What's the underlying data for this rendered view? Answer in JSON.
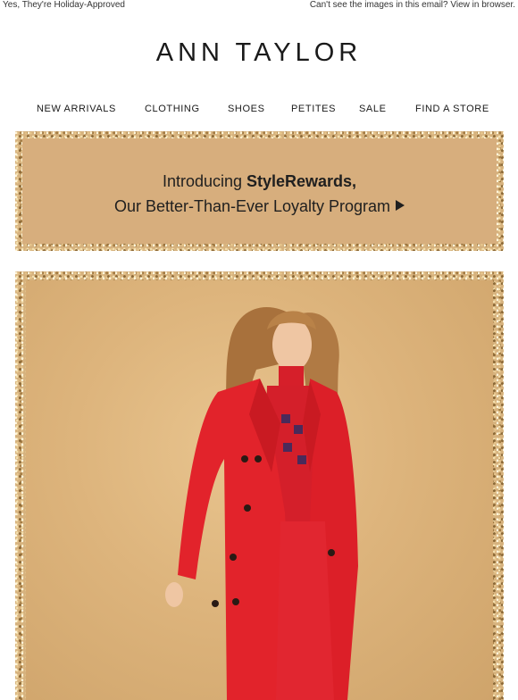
{
  "preheader": {
    "left_text": "Yes, They're Holiday-Approved",
    "right_text": "Can't see the images in this email? View in browser."
  },
  "brand": {
    "logo_text": "ANN TAYLOR"
  },
  "nav": {
    "items": [
      {
        "label": "NEW ARRIVALS"
      },
      {
        "label": "CLOTHING"
      },
      {
        "label": "SHOES"
      },
      {
        "label": "PETITES"
      },
      {
        "label": "SALE"
      },
      {
        "label": "FIND A STORE"
      }
    ]
  },
  "promo": {
    "line1_prefix": "Introducing ",
    "line1_bold": "StyleRewards,",
    "line2": "Our Better-Than-Ever Loyalty Program",
    "icon": "play-arrow-icon"
  },
  "hero": {
    "image": "model-red-coat-photo",
    "colors": {
      "coat": "#e2232b",
      "background": "#ddb47c",
      "frame": "gold-glitter"
    }
  }
}
